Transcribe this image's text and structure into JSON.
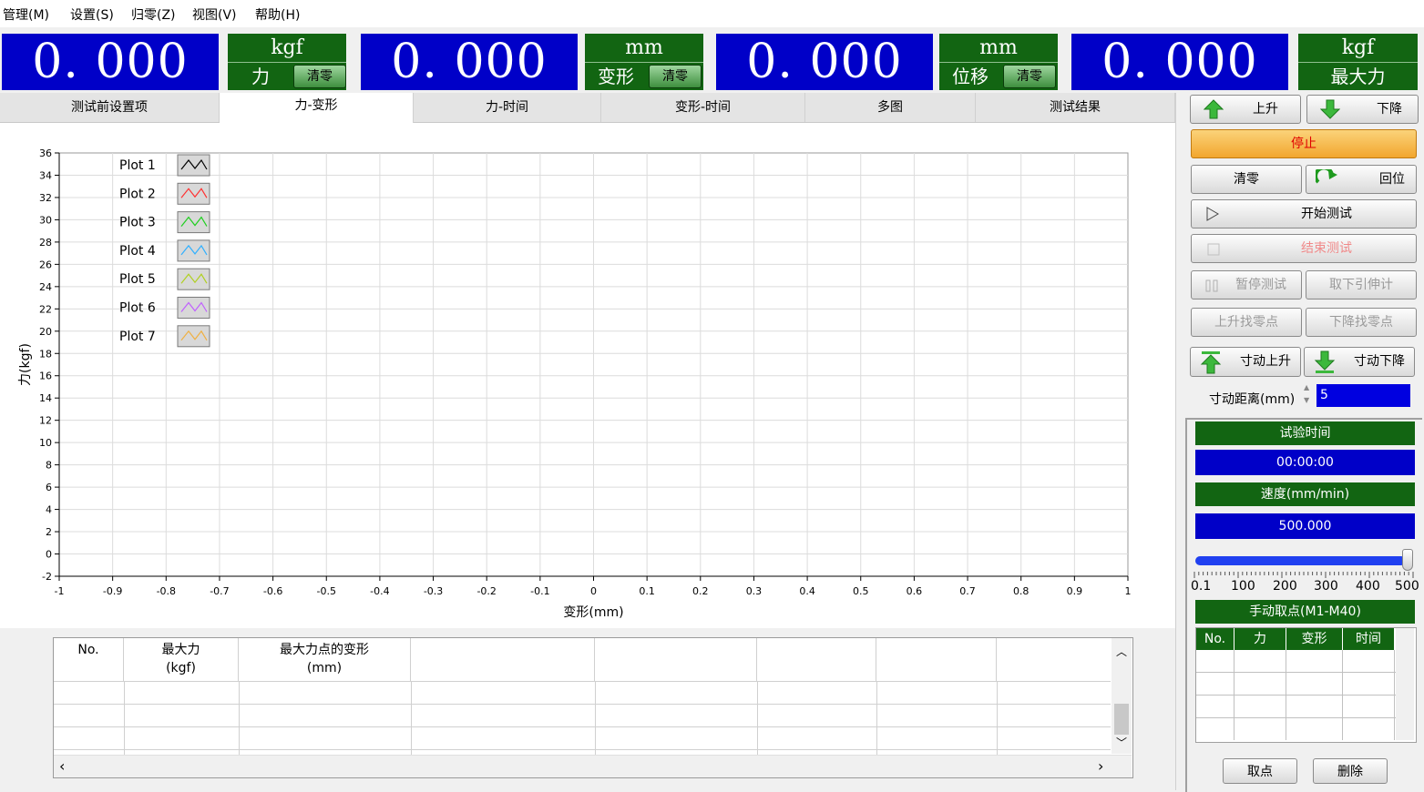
{
  "menu": [
    "管理(M)",
    "设置(S)",
    "归零(Z)",
    "视图(V)",
    "帮助(H)"
  ],
  "readouts": [
    {
      "value": "0. 000",
      "unit": "kgf",
      "label": "力",
      "zero": "清零"
    },
    {
      "value": "0. 000",
      "unit": "mm",
      "label": "变形",
      "zero": "清零"
    },
    {
      "value": "0. 000",
      "unit": "mm",
      "label": "位移",
      "zero": "清零"
    },
    {
      "value": "0. 000",
      "unit": "kgf",
      "label": "最大力"
    }
  ],
  "tabs": [
    "测试前设置项",
    "力-变形",
    "力-时间",
    "变形-时间",
    "多图",
    "测试结果"
  ],
  "active_tab": "力-变形",
  "chart_data": {
    "type": "line",
    "xlabel": "变形(mm)",
    "ylabel": "力(kgf)",
    "xlim": [
      -1,
      1
    ],
    "ylim": [
      -2,
      36
    ],
    "x_ticks": [
      "-1",
      "-0.9",
      "-0.8",
      "-0.7",
      "-0.6",
      "-0.5",
      "-0.4",
      "-0.3",
      "-0.2",
      "-0.1",
      "0",
      "0.1",
      "0.2",
      "0.3",
      "0.4",
      "0.5",
      "0.6",
      "0.7",
      "0.8",
      "0.9",
      "1"
    ],
    "y_ticks": [
      "-2",
      "0",
      "2",
      "4",
      "6",
      "8",
      "10",
      "12",
      "14",
      "16",
      "18",
      "20",
      "22",
      "24",
      "26",
      "28",
      "30",
      "32",
      "34",
      "36"
    ],
    "grid": true,
    "legend_position": "top-left",
    "series": [
      {
        "name": "Plot 1",
        "color": "#000000",
        "values": []
      },
      {
        "name": "Plot 2",
        "color": "#ff3030",
        "values": []
      },
      {
        "name": "Plot 3",
        "color": "#20d020",
        "values": []
      },
      {
        "name": "Plot 4",
        "color": "#30b0ff",
        "values": []
      },
      {
        "name": "Plot 5",
        "color": "#b0d020",
        "values": []
      },
      {
        "name": "Plot 6",
        "color": "#c060ff",
        "values": []
      },
      {
        "name": "Plot 7",
        "color": "#f0b040",
        "values": []
      }
    ]
  },
  "results_table": {
    "columns": [
      {
        "l1": "No.",
        "l2": ""
      },
      {
        "l1": "最大力",
        "l2": "(kgf)"
      },
      {
        "l1": "最大力点的变形",
        "l2": "(mm)"
      },
      {
        "l1": "",
        "l2": ""
      },
      {
        "l1": "",
        "l2": ""
      },
      {
        "l1": "",
        "l2": ""
      },
      {
        "l1": "",
        "l2": ""
      }
    ],
    "rows": []
  },
  "controls": {
    "up": "上升",
    "down": "下降",
    "stop": "停止",
    "zero": "清零",
    "return": "回位",
    "start": "开始测试",
    "end": "结束测试",
    "pause": "暂停测试",
    "remove_ext": "取下引伸计",
    "up_find_zero": "上升找零点",
    "down_find_zero": "下降找零点",
    "jog_up": "寸动上升",
    "jog_down": "寸动下降",
    "jog_distance_label": "寸动距离(mm)",
    "jog_distance_value": "5"
  },
  "status": {
    "test_time_label": "试验时间",
    "test_time_value": "00:00:00",
    "speed_label": "速度(mm/min)",
    "speed_value": "500.000",
    "speed_fraction": 1.0,
    "speed_ticks": [
      "0.1",
      "100",
      "200",
      "300",
      "400",
      "500"
    ],
    "manual_points_label": "手动取点(M1-M40)",
    "points_columns": [
      "No.",
      "力",
      "变形",
      "时间"
    ],
    "take_point": "取点",
    "delete": "删除"
  },
  "colors": {
    "readout_blue": "#0000c8",
    "label_green": "#126512",
    "stop_orange": "#f5b040"
  }
}
